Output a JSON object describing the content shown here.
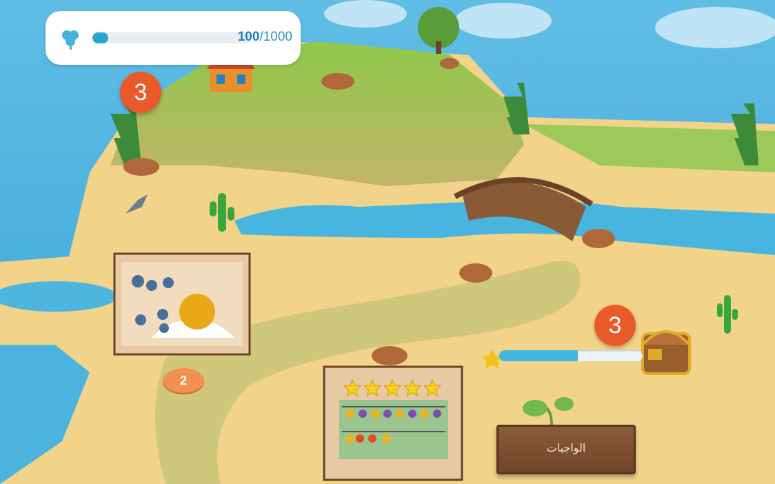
{
  "hud": {
    "icon": "clover-icon",
    "progress_current": "100",
    "progress_separator": "/",
    "progress_total": "1000",
    "progress_fraction": 0.1
  },
  "badges": {
    "top_left_count": "3",
    "chest_count": "3"
  },
  "levels": {
    "current_level_number": "2"
  },
  "level_cards": [
    {
      "name": "seashell-puzzle-card"
    },
    {
      "name": "fruit-garden-card",
      "stars": 5
    }
  ],
  "chest_progress": {
    "fraction": 0.55
  },
  "sign": {
    "label": "الواجبات"
  },
  "colors": {
    "badge": "#e85a2a",
    "hud_bar": "#29a6d6",
    "water": "#4fb3e0",
    "sand": "#f1d389",
    "grass": "#8cc14a"
  }
}
